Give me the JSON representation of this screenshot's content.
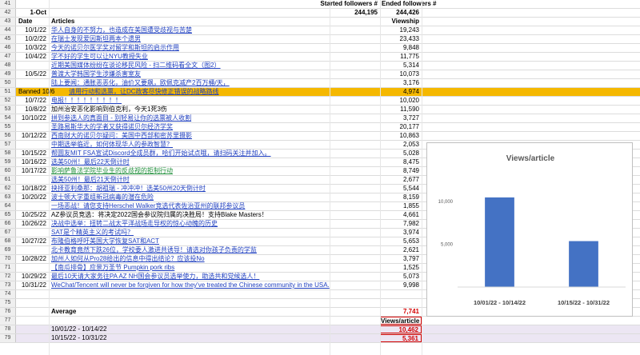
{
  "header": {
    "started_label": "Started followers #",
    "ended_label": "Ended followers #",
    "date_value": "1-Oct",
    "started_value": "244,195",
    "ended_value": "244,426",
    "col_date": "Date",
    "col_articles": "Articles",
    "col_viewship": "Viewship"
  },
  "rows": [
    {
      "num": "41",
      "date": "",
      "article": "",
      "views": "",
      "style": "blank"
    },
    {
      "num": "42",
      "date": "",
      "article": "",
      "views": "",
      "style": "blank"
    },
    {
      "num": "43",
      "date": "",
      "article": "",
      "views": "",
      "style": "blank"
    },
    {
      "num": "44",
      "date": "10/1/22",
      "article": "华人自身的不努力，也造成在美国遭受歧视与苦楚",
      "views": "19,243",
      "style": "link"
    },
    {
      "num": "45",
      "date": "10/2/22",
      "article": "在瑞士发现爱因斯坦两本个遗男",
      "views": "23,433",
      "style": "link"
    },
    {
      "num": "46",
      "date": "10/3/22",
      "article": "今天的诺贝尔医学奖对留学和斯坦的启示作用",
      "views": "9,848",
      "style": "link"
    },
    {
      "num": "47",
      "date": "10/4/22",
      "article": "学不好的学生可以让NYU教授失业",
      "views": "11,775",
      "style": "link"
    },
    {
      "num": "48",
      "date": "",
      "article": "近期美国媒体纷纷在谈论移民风险 - 扫二维码看全文（图2）",
      "views": "5,314",
      "style": "link"
    },
    {
      "num": "49",
      "date": "10/5/22",
      "article": "普渡大学韩国学生涉嫌杀害室友",
      "views": "10,073",
      "style": "link"
    },
    {
      "num": "50",
      "date": "",
      "article": "陆上要闻：通胀恶恶化，油价又要飙，欧佩克减产2百万桶/天，",
      "views": "3,176",
      "style": "link"
    },
    {
      "num": "51",
      "date": "Banned 10/6",
      "article": "请用行动和选票，让DC政客尽快修正错误的战略路线",
      "views": "4,974",
      "style": "banned"
    },
    {
      "num": "52",
      "date": "10/7/22",
      "article": "电报！！！！！！！！！",
      "views": "10,020",
      "style": "link"
    },
    {
      "num": "53",
      "date": "10/8/22",
      "article": "加州治安恶化影响到伯克利，今天1死3伤",
      "views": "11,590",
      "style": "plain"
    },
    {
      "num": "54",
      "date": "10/10/22",
      "article": "拼到参选人的真面目 - 别轻易让你的选票被人收割",
      "views": "3,727",
      "style": "link"
    },
    {
      "num": "55",
      "date": "",
      "article": "圣路易斯华大的学者又获得诺贝尔经济学奖",
      "views": "20,177",
      "style": "link"
    },
    {
      "num": "56",
      "date": "10/12/22",
      "article": "西南财大的诺贝尔疑问：美国中西部和密苏里摄影",
      "views": "10,863",
      "style": "link"
    },
    {
      "num": "57",
      "date": "",
      "article": "中期选举临近，如何体现华人的参政智慧？",
      "views": "2,053",
      "style": "link"
    },
    {
      "num": "58",
      "date": "10/15/22",
      "article": "帮圆友MIT FSA宣试Discord全成员群，哈们开始试点哦，请扫码关注并加入。",
      "views": "5,028",
      "style": "link"
    },
    {
      "num": "59",
      "date": "10/16/22",
      "article": "选美50州！最后22天倒计时",
      "views": "8,475",
      "style": "link"
    },
    {
      "num": "60",
      "date": "10/17/22",
      "article": "影响萨鲁法学院毕业生的反歧视的拒制行动",
      "views": "8,749",
      "style": "green"
    },
    {
      "num": "61",
      "date": "",
      "article": "选美50州！最后21天倒计时",
      "views": "2,677",
      "style": "link"
    },
    {
      "num": "62",
      "date": "10/18/22",
      "article": "抉择亚利桑那：胡祖瑞 - 冲冲冲！选美50州20天倒计时",
      "views": "5,544",
      "style": "link"
    },
    {
      "num": "63",
      "date": "10/20/22",
      "article": "波士顿大学重组新冠病毒的潜在危险",
      "views": "8,159",
      "style": "link"
    },
    {
      "num": "64",
      "date": "",
      "article": "一场恶战！请您支持Herschel Walker竞选代表佐治亚州的联邦参议员",
      "views": "1,855",
      "style": "link"
    },
    {
      "num": "65",
      "date": "10/25/22",
      "article": "AZ参议员竞选：将决定2022国会参议院归属的决胜局！支持Blake Masters！",
      "views": "4,661",
      "style": "plain"
    },
    {
      "num": "66",
      "date": "10/26/22",
      "article": "决战中选举：扭转二战太平洋战场走导权的惊心动魄的历史",
      "views": "7,982",
      "style": "link"
    },
    {
      "num": "67",
      "date": "",
      "article": "SAT是个精英主义的考试吗？",
      "views": "3,974",
      "style": "link"
    },
    {
      "num": "68",
      "date": "10/27/22",
      "article": "布隆伯格呼吁美国大学恢复SAT和ACT",
      "views": "5,653",
      "style": "link"
    },
    {
      "num": "69",
      "date": "",
      "article": "北卡教育竟然下跌26位，学校委人激进共诱导！请选对你孩子负责的学监",
      "views": "2,621",
      "style": "link"
    },
    {
      "num": "70",
      "date": "10/28/22",
      "article": "加州人如何从Pro28给出的信息中得出结论？应该投No",
      "views": "3,797",
      "style": "link"
    },
    {
      "num": "71",
      "date": "",
      "article": "【南瓜排骨】应景万圣节 Pumpkin pork ribs",
      "views": "1,525",
      "style": "link"
    },
    {
      "num": "72",
      "date": "10/29/22",
      "article": "最后10天请大家务往PA AZ NH国会参议员选举使力，助选共和党候选人！",
      "views": "5,073",
      "style": "link"
    },
    {
      "num": "73",
      "date": "10/31/22",
      "article": "WeChat/Tencent will never be forgiven for how they've treated the Chinese community in the USA.",
      "views": "9,998",
      "style": "link"
    },
    {
      "num": "74",
      "date": "",
      "article": "",
      "views": "",
      "style": "blank"
    }
  ],
  "summary": {
    "n75": "75",
    "n76": "76",
    "n77": "77",
    "n78": "78",
    "n79": "79",
    "average_label": "Average",
    "average_value": "7,741",
    "views_article_label": "Views/article",
    "range1_label": "10/01/22 - 10/14/22",
    "range1_value": "10,462",
    "range2_label": "10/15/22 - 10/31/22",
    "range2_value": "5,361"
  },
  "chart_data": {
    "type": "bar",
    "title": "Views/article",
    "categories": [
      "10/01/22 - 10/14/22",
      "10/15/22 - 10/31/22"
    ],
    "values": [
      10462,
      5361
    ],
    "ylim": [
      0,
      14000
    ],
    "yticks": [
      5000,
      10000
    ],
    "ytick_labels": [
      "5,000",
      "10,000"
    ],
    "bar_color": "#4472c4",
    "grid": false,
    "legend": "none"
  },
  "colors": {
    "link": "#1f3fbf",
    "banned_highlight": "#f5b800",
    "red_value": "#d40000",
    "bar": "#4472c4"
  }
}
